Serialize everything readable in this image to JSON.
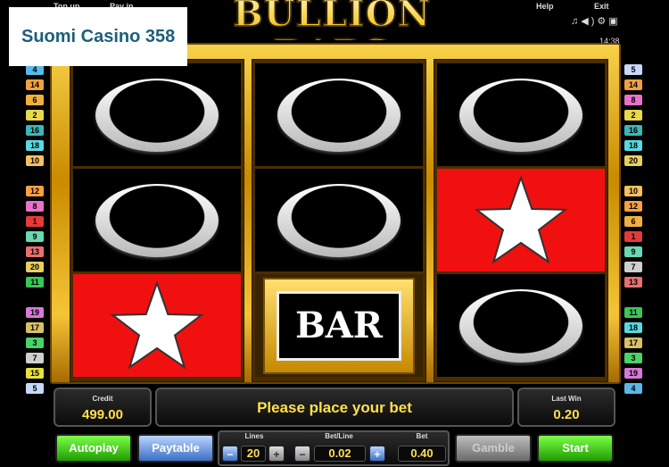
{
  "topbar": {
    "top_up": "Top up",
    "pay_in": "Pay in",
    "help": "Help",
    "exit": "Exit",
    "sys_icons": [
      "music-icon",
      "sound-icon",
      "settings-icon",
      "fullscreen-icon"
    ],
    "time": "14:38"
  },
  "watermark": "Suomi Casino 358",
  "logo": "BULLION BARS",
  "reels": [
    [
      "ring",
      "ring",
      "star"
    ],
    [
      "ring",
      "ring",
      "bar"
    ],
    [
      "ring",
      "star",
      "ring"
    ]
  ],
  "bar_label": "BAR",
  "left_lines": [
    "4",
    "14",
    "6",
    "2",
    "16",
    "18",
    "10",
    "12",
    "8",
    "1",
    "9",
    "13",
    "20",
    "11",
    "19",
    "17",
    "3",
    "7",
    "15",
    "5"
  ],
  "right_lines": [
    "5",
    "14",
    "8",
    "2",
    "16",
    "18",
    "20",
    "10",
    "12",
    "6",
    "1",
    "9",
    "7",
    "13",
    "11",
    "18",
    "17",
    "3",
    "19",
    "4"
  ],
  "line_colors": {
    "1": "#e43a3a",
    "2": "#e8d84a",
    "3": "#4ad36b",
    "4": "#5ab8e8",
    "5": "#c8d8f8",
    "6": "#f0b040",
    "7": "#cfcfcf",
    "8": "#e872c8",
    "9": "#6ad8b0",
    "10": "#f4c060",
    "11": "#38c858",
    "12": "#f8a040",
    "13": "#e87070",
    "14": "#f0a040",
    "15": "#e8e040",
    "16": "#3ab8b8",
    "17": "#d8c068",
    "18": "#5ad8e0",
    "19": "#d878d8",
    "20": "#e8d060"
  },
  "credit": {
    "label": "Credit",
    "value": "499.00"
  },
  "message": "Please place your bet",
  "last_win": {
    "label": "Last Win",
    "value": "0.20"
  },
  "buttons": {
    "autoplay": "Autoplay",
    "paytable": "Paytable",
    "gamble": "Gamble",
    "start": "Start"
  },
  "lines": {
    "label": "Lines",
    "value": "20"
  },
  "bet_line": {
    "label": "Bet/Line",
    "value": "0.02"
  },
  "bet": {
    "label": "Bet",
    "value": "0.40"
  }
}
